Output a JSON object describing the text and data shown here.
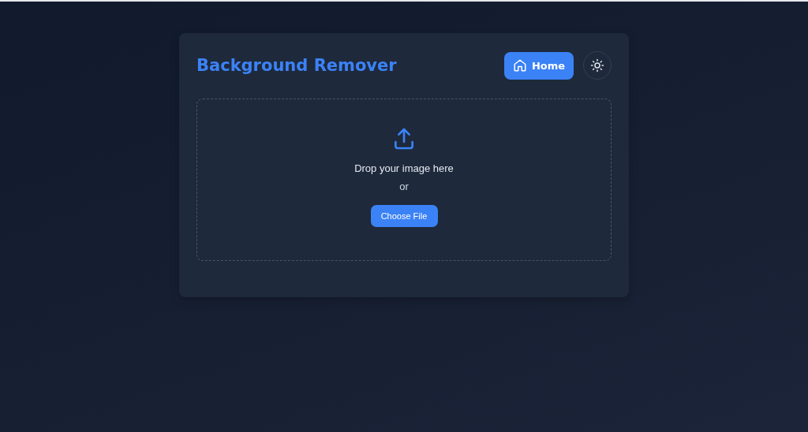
{
  "header": {
    "title": "Background Remover",
    "home_button": "Home"
  },
  "dropzone": {
    "prompt": "Drop your image here",
    "separator": "or",
    "button": "Choose File"
  }
}
